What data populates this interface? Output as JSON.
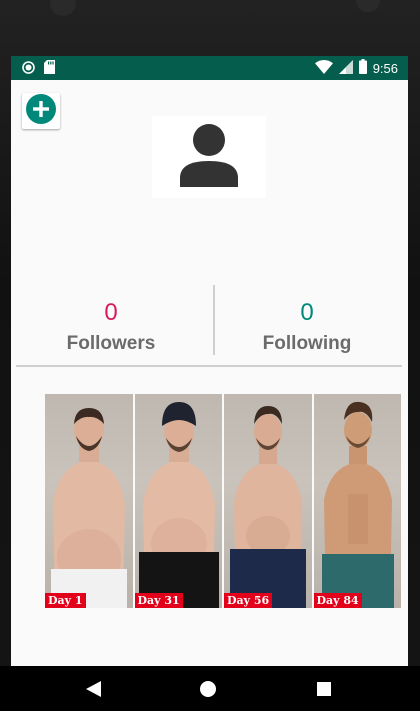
{
  "status_bar": {
    "time": "9:56",
    "icons": [
      "notification-dot-icon",
      "sd-card-icon",
      "wifi-icon",
      "cell-signal-icon",
      "battery-icon"
    ],
    "background_color": "#055e4d"
  },
  "actions": {
    "add_icon": "plus-circle-icon",
    "accent_color": "#00897b"
  },
  "profile": {
    "avatar_icon": "person-icon"
  },
  "stats": {
    "followers": {
      "count": "0",
      "label": "Followers",
      "color": "#d81b60"
    },
    "following": {
      "count": "0",
      "label": "Following",
      "color": "#00897b"
    }
  },
  "progress_photos": [
    {
      "label": "Day 1"
    },
    {
      "label": "Day 31"
    },
    {
      "label": "Day 56"
    },
    {
      "label": "Day 84"
    }
  ],
  "nav_bar": {
    "icons": [
      "back-icon",
      "home-icon",
      "recents-icon"
    ]
  }
}
